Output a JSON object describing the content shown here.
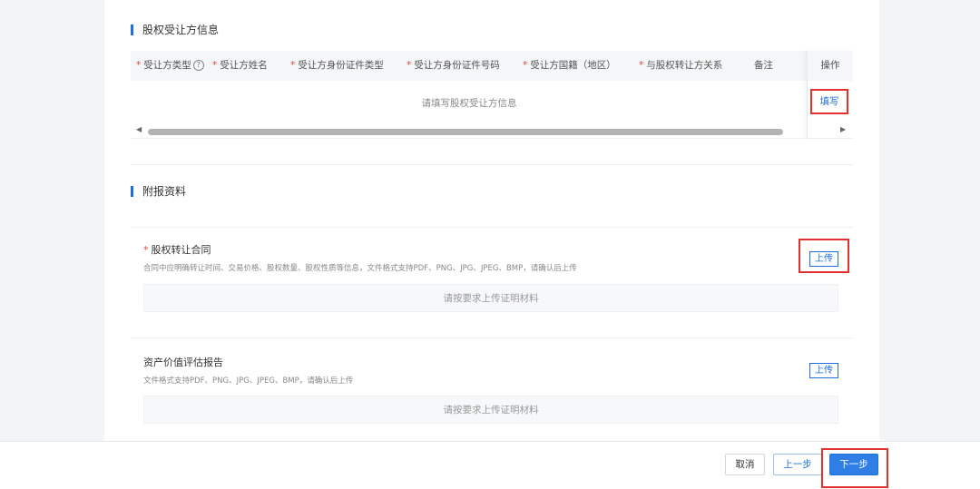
{
  "section_transferee": {
    "title": "股权受让方信息",
    "columns": [
      {
        "label": "受让方类型",
        "required": true,
        "help": true
      },
      {
        "label": "受让方姓名",
        "required": true
      },
      {
        "label": "受让方身份证件类型",
        "required": true
      },
      {
        "label": "受让方身份证件号码",
        "required": true
      },
      {
        "label": "受让方国籍（地区）",
        "required": true
      },
      {
        "label": "与股权转让方关系",
        "required": true
      },
      {
        "label": "备注",
        "required": false
      }
    ],
    "operation_header": "操作",
    "empty_text": "请填写股权受让方信息",
    "fill_link": "填写"
  },
  "section_attachments": {
    "title": "附报资料",
    "cards": [
      {
        "title": "股权转让合同",
        "required": true,
        "desc": "合同中应明确转让时间、交易价格、股权数量、股权性质等信息，文件格式支持PDF、PNG、JPG、JPEG、BMP，请确认后上传",
        "upload_label": "上传",
        "dropzone_text": "请按要求上传证明材料"
      },
      {
        "title": "资产价值评估报告",
        "required": false,
        "desc": "文件格式支持PDF、PNG、JPG、JPEG、BMP，请确认后上传",
        "upload_label": "上传",
        "dropzone_text": "请按要求上传证明材料"
      }
    ]
  },
  "footer": {
    "cancel_label": "取消",
    "prev_label": "上一步",
    "next_label": "下一步"
  },
  "colors": {
    "accent": "#2f7ee6",
    "required": "#e04545",
    "highlight": "#e0312e"
  }
}
